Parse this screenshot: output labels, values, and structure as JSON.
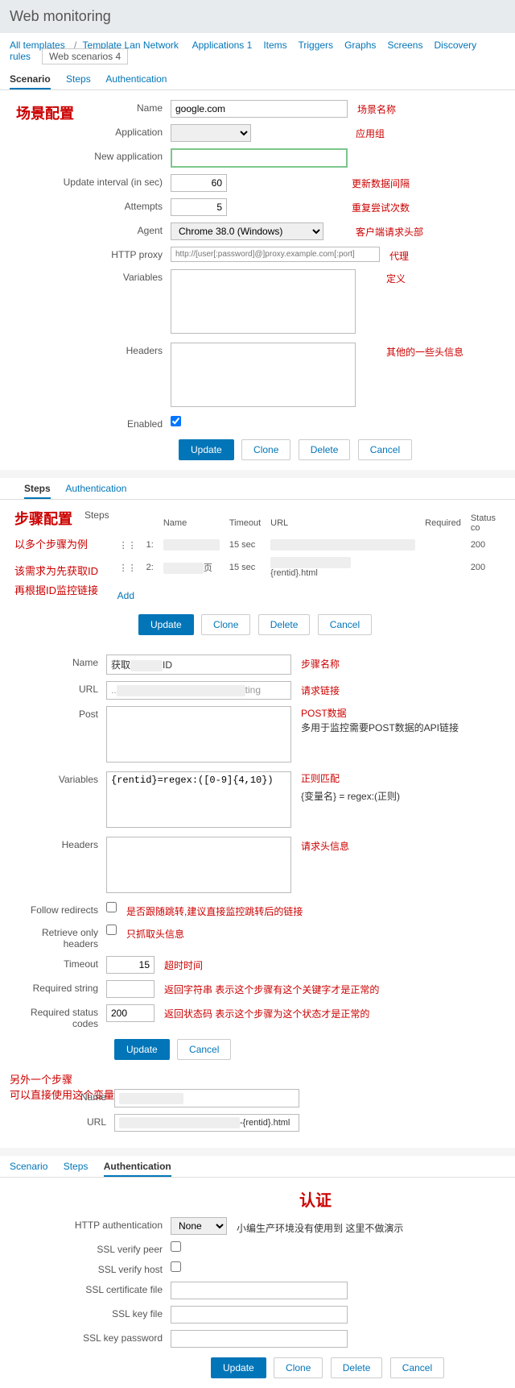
{
  "header": {
    "title": "Web monitoring"
  },
  "breadcrumb": {
    "all_templates": "All templates",
    "template_name": "Template Lan Network",
    "items": [
      {
        "label": "Applications 1"
      },
      {
        "label": "Items"
      },
      {
        "label": "Triggers"
      },
      {
        "label": "Graphs"
      },
      {
        "label": "Screens"
      },
      {
        "label": "Discovery rules"
      }
    ],
    "active": "Web scenarios 4"
  },
  "tabs1": {
    "scenario": "Scenario",
    "steps": "Steps",
    "auth": "Authentication"
  },
  "section1_title": "场景配置",
  "scenario": {
    "labels": {
      "name": "Name",
      "application": "Application",
      "new_application": "New application",
      "update_interval": "Update interval (in sec)",
      "attempts": "Attempts",
      "agent": "Agent",
      "http_proxy": "HTTP proxy",
      "variables": "Variables",
      "headers": "Headers",
      "enabled": "Enabled"
    },
    "name": "google.com",
    "update_interval": "60",
    "attempts": "5",
    "agent": "Chrome 38.0 (Windows)",
    "http_proxy_placeholder": "http://[user[:password]@]proxy.example.com[:port]",
    "enabled": true,
    "notes": {
      "name": "场景名称",
      "application": "应用组",
      "update_interval": "更新数据间隔",
      "attempts": "重复尝试次数",
      "agent": "客户端请求头部",
      "http_proxy": "代理",
      "variables": "定义",
      "headers": "其他的一些头信息"
    }
  },
  "buttons": {
    "update": "Update",
    "clone": "Clone",
    "delete": "Delete",
    "cancel": "Cancel"
  },
  "section2_title": "步骤配置",
  "section2_notes": [
    "以多个步骤为例",
    "该需求为先获取ID",
    "再根据ID监控链接"
  ],
  "steps_table": {
    "label": "Steps",
    "headers": {
      "name": "Name",
      "timeout": "Timeout",
      "url": "URL",
      "required": "Required",
      "status": "Status co"
    },
    "rows": [
      {
        "num": "1:",
        "timeout": "15 sec",
        "status": "200"
      },
      {
        "num": "2:",
        "suffix": "页",
        "timeout": "15 sec",
        "url_suffix": "{rentid}.html",
        "status": "200"
      }
    ],
    "add": "Add"
  },
  "step_detail": {
    "labels": {
      "name": "Name",
      "url": "URL",
      "post": "Post",
      "variables": "Variables",
      "headers": "Headers",
      "follow_redirects": "Follow redirects",
      "retrieve_headers": "Retrieve only headers",
      "timeout": "Timeout",
      "required_string": "Required string",
      "required_status": "Required status codes"
    },
    "name_prefix": "获取",
    "name_suffix": "ID",
    "url_suffix": "ting",
    "variables": "{rentid}=regex:([0-9]{4,10})",
    "timeout": "15",
    "required_status": "200",
    "notes": {
      "name": "步骤名称",
      "url": "请求链接",
      "post": "POST数据",
      "post2": "多用于监控需要POST数据的API链接",
      "variables": "正则匹配",
      "variables2": "{变量名} = regex:(正则)",
      "headers": "请求头信息",
      "follow_redirects": "是否跟随跳转,建议直接监控跳转后的链接",
      "retrieve_headers": "只抓取头信息",
      "timeout": "超时时间",
      "required_string": "返回字符串  表示这个步骤有这个关键字才是正常的",
      "required_status": "返回状态码  表示这个步骤为这个状态才是正常的"
    }
  },
  "another_step": {
    "title": "另外一个步骤",
    "subtitle": "可以直接使用这个变量",
    "labels": {
      "name": "Name",
      "url": "URL"
    },
    "url_suffix": "-{rentid}.html"
  },
  "auth": {
    "title": "认证",
    "note": "小编生产环境没有使用到 这里不做演示",
    "labels": {
      "http_auth": "HTTP authentication",
      "verify_peer": "SSL verify peer",
      "verify_host": "SSL verify host",
      "cert_file": "SSL certificate file",
      "key_file": "SSL key file",
      "key_password": "SSL key password"
    },
    "http_auth_value": "None"
  }
}
